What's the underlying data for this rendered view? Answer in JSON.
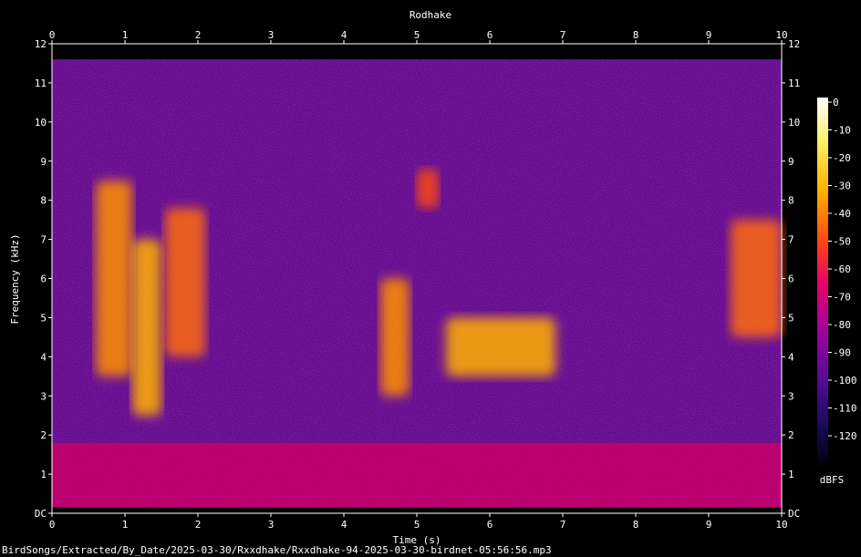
{
  "chart_data": {
    "type": "heatmap",
    "title": "Rodhake",
    "xlabel": "Time (s)",
    "ylabel": "Frequency (kHz)",
    "xlim": [
      0,
      10
    ],
    "ylim": [
      0,
      12
    ],
    "x_ticks": [
      "0",
      "1",
      "2",
      "3",
      "4",
      "5",
      "6",
      "7",
      "8",
      "9",
      "10"
    ],
    "y_ticks": [
      "DC",
      "1",
      "2",
      "3",
      "4",
      "5",
      "6",
      "7",
      "8",
      "9",
      "10",
      "11",
      "12"
    ],
    "colorbar": {
      "label": "dBFS",
      "ticks": [
        "0",
        "-10",
        "-20",
        "-30",
        "-40",
        "-50",
        "-60",
        "-70",
        "-80",
        "-90",
        "-100",
        "-110",
        "-120"
      ],
      "range": [
        -120,
        0
      ]
    },
    "energy_regions": [
      {
        "t": [
          0.6,
          1.1
        ],
        "f": [
          3.5,
          8.5
        ],
        "level_dbfs": -35
      },
      {
        "t": [
          1.1,
          1.5
        ],
        "f": [
          2.5,
          7.0
        ],
        "level_dbfs": -30
      },
      {
        "t": [
          1.55,
          2.1
        ],
        "f": [
          4.0,
          7.8
        ],
        "level_dbfs": -40
      },
      {
        "t": [
          4.5,
          4.9
        ],
        "f": [
          3.0,
          6.0
        ],
        "level_dbfs": -35
      },
      {
        "t": [
          5.4,
          6.9
        ],
        "f": [
          3.5,
          5.0
        ],
        "level_dbfs": -30
      },
      {
        "t": [
          5.0,
          5.3
        ],
        "f": [
          7.8,
          8.8
        ],
        "level_dbfs": -45
      },
      {
        "t": [
          9.3,
          10.0
        ],
        "f": [
          4.5,
          7.5
        ],
        "level_dbfs": -40
      }
    ],
    "background_level_dbfs": -85,
    "low_band_level_dbfs": -65,
    "low_band_khz": [
      0,
      1.8
    ]
  },
  "footer": {
    "path": "BirdSongs/Extracted/By_Date/2025-03-30/Rxxdhake/Rxxdhake-94-2025-03-30-birdnet-05:56:56.mp3"
  }
}
